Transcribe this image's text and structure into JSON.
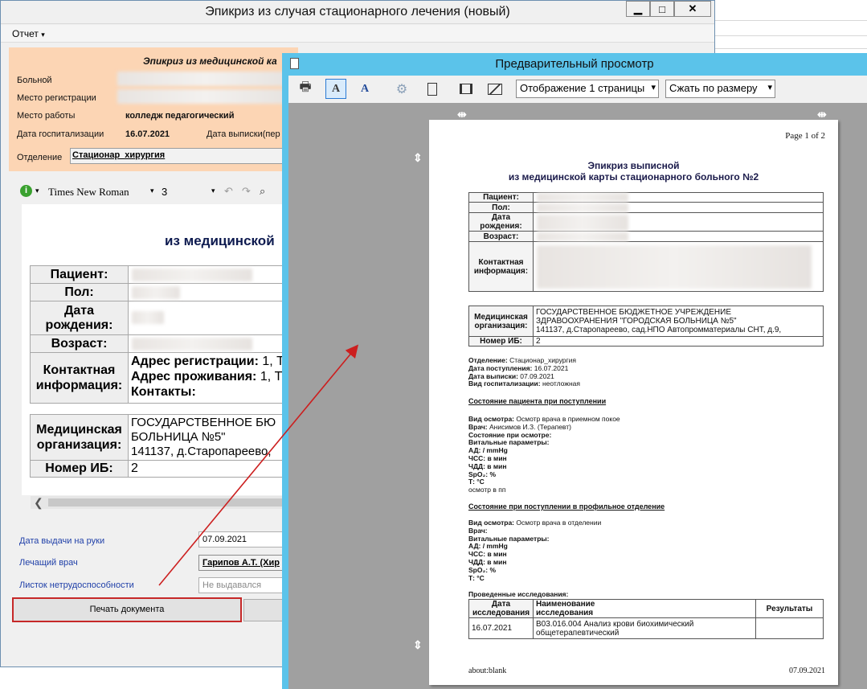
{
  "editor_window": {
    "title": "Эпикриз из случая стационарного лечения (новый)",
    "menu": {
      "report_label": "Отчет",
      "caret": "▾"
    },
    "header": {
      "title": "Эпикриз из медицинской ка",
      "patient_label": "Больной",
      "reg_place_label": "Место регистрации",
      "work_place_label": "Место работы",
      "work_place_value": "колледж педагогический",
      "admission_date_label": "Дата госпитализации",
      "admission_date_value": "16.07.2021",
      "discharge_date_label": "Дата выписки(пер",
      "department_label": "Отделение",
      "department_value": "Стационар_хирургия"
    },
    "editor_toolbar": {
      "font_name": "Times New Roman",
      "font_size": "3",
      "caret": "▾",
      "info_glyph": "i",
      "undo_glyph": "↶",
      "redo_glyph": "↷",
      "find_glyph": "⌕"
    },
    "document": {
      "title": "из медицинской",
      "rows": {
        "patient": "Пациент:",
        "sex": "Пол:",
        "birth_1": "Дата",
        "birth_2": "рождения:",
        "age": "Возраст:",
        "contact_1": "Контактная",
        "contact_2": "информация:",
        "reg_addr_label": "Адрес регистрации:",
        "reg_addr_value": " 1, Т",
        "live_addr_label": "Адрес проживания:",
        "live_addr_value": " 1, Т",
        "contacts_label": "Контакты:",
        "org_1": "Медицинская",
        "org_2": "организация:",
        "org_value_1": "ГОСУДАРСТВЕННОЕ БЮ",
        "org_value_2": "БОЛЬНИЦА №5\"",
        "org_value_3": "141137, д.Старопареево,",
        "ib_label": "Номер ИБ:",
        "ib_value": "2"
      },
      "scroll_left": "❮"
    },
    "bottom": {
      "issue_date_label": "Дата выдачи на руки",
      "issue_date_value": "07.09.2021",
      "doctor_label": "Лечащий врач",
      "doctor_value": "Гарипов А.Т. (Хир",
      "sick_leave_label": "Листок нетрудоспособности",
      "sick_leave_placeholder": "Не выдавался",
      "print_button": "Печать документа"
    },
    "win_buttons": {
      "minimize": "▁",
      "maximize": "□",
      "close": "✕"
    }
  },
  "preview_window": {
    "title": "Предварительный просмотр",
    "toolbar": {
      "print_icon": "🖶",
      "text_a1": "A",
      "text_a2": "A",
      "gear_icon": "⚙",
      "page_select": "Отображение 1 страницы",
      "fit_select": "Сжать по размеру",
      "dd": "▾"
    },
    "move_glyph_h": "⇹",
    "move_glyph_v": "⇕",
    "page": {
      "page_no": "Page 1 of 2",
      "title_1": "Эпикриз выписной",
      "title_2": "из медицинской карты стационарного больного №2",
      "patient": "Пациент:",
      "sex": "Пол:",
      "birth_1": "Дата",
      "birth_2": "рождения:",
      "age": "Возраст:",
      "contact_1": "Контактная",
      "contact_2": "информация:",
      "org_1": "Медицинская",
      "org_2": "организация:",
      "org_value_1": "ГОСУДАРСТВЕННОЕ БЮДЖЕТНОЕ УЧРЕЖДЕНИЕ",
      "org_value_2": "ЗДРАВООХРАНЕНИЯ \"ГОРОДСКАЯ БОЛЬНИЦА №5\"",
      "org_value_3": "141137, д.Старопареево, сад.НПО Автопромматериалы СНТ, д.9,",
      "ib_label": "Номер ИБ:",
      "ib_value": "2",
      "dept_label": "Отделение:",
      "dept_value": " Стационар_хирургия",
      "admit_label": "Дата поступления:",
      "admit_value": " 16.07.2021",
      "disch_label": "Дата выписки:",
      "disch_value": " 07.09.2021",
      "hosp_type_label": "Вид госпитализации:",
      "hosp_type_value": " неотложная",
      "sec1": "Состояние пациента при поступлении",
      "exam1_label": "Вид осмотра:",
      "exam1_value": " Осмотр врача в приемном покое",
      "doctor_label": "Врач:",
      "doctor_value": " Анисимов И.З. (Терапевт)",
      "state_label": "Состояние при осмотре:",
      "vitals_label": "Витальные параметры:",
      "ad": "АД: / mmHg",
      "hr": "ЧСС: в мин",
      "rr": "ЧДД: в мин",
      "spo2": "SpO₂: %",
      "temp": "Т: °С",
      "exam_pp": "осмотр в пп",
      "sec2": "Состояние при поступлении в профильное отделение",
      "exam2_label": "Вид осмотра:",
      "exam2_value": " Осмотр врача в отделении",
      "doctor2_label": "Врач:",
      "vitals2_label": "Витальные параметры:",
      "ad2": "АД: / mmHg",
      "hr2": "ЧСС: в мин",
      "rr2": "ЧДД: в мин",
      "spo22": "SpO₂: %",
      "temp2": "Т: °С",
      "studies_label": "Проведенные исследования:",
      "col_date_1": "Дата",
      "col_date_2": "исследования",
      "col_name_1": "Наименование",
      "col_name_2": "исследования",
      "col_results": "Результаты",
      "study_date": "16.07.2021",
      "study_name_1": "B03.016.004 Анализ крови биохимический",
      "study_name_2": "общетерапевтический",
      "footer_left": "about:blank",
      "footer_right": "07.09.2021"
    }
  },
  "colors": {
    "peach": "#fcd5b4",
    "preview_title_bar": "#5bc3ea",
    "arrow": "#cc1f1f",
    "link": "#1f3fa8"
  }
}
